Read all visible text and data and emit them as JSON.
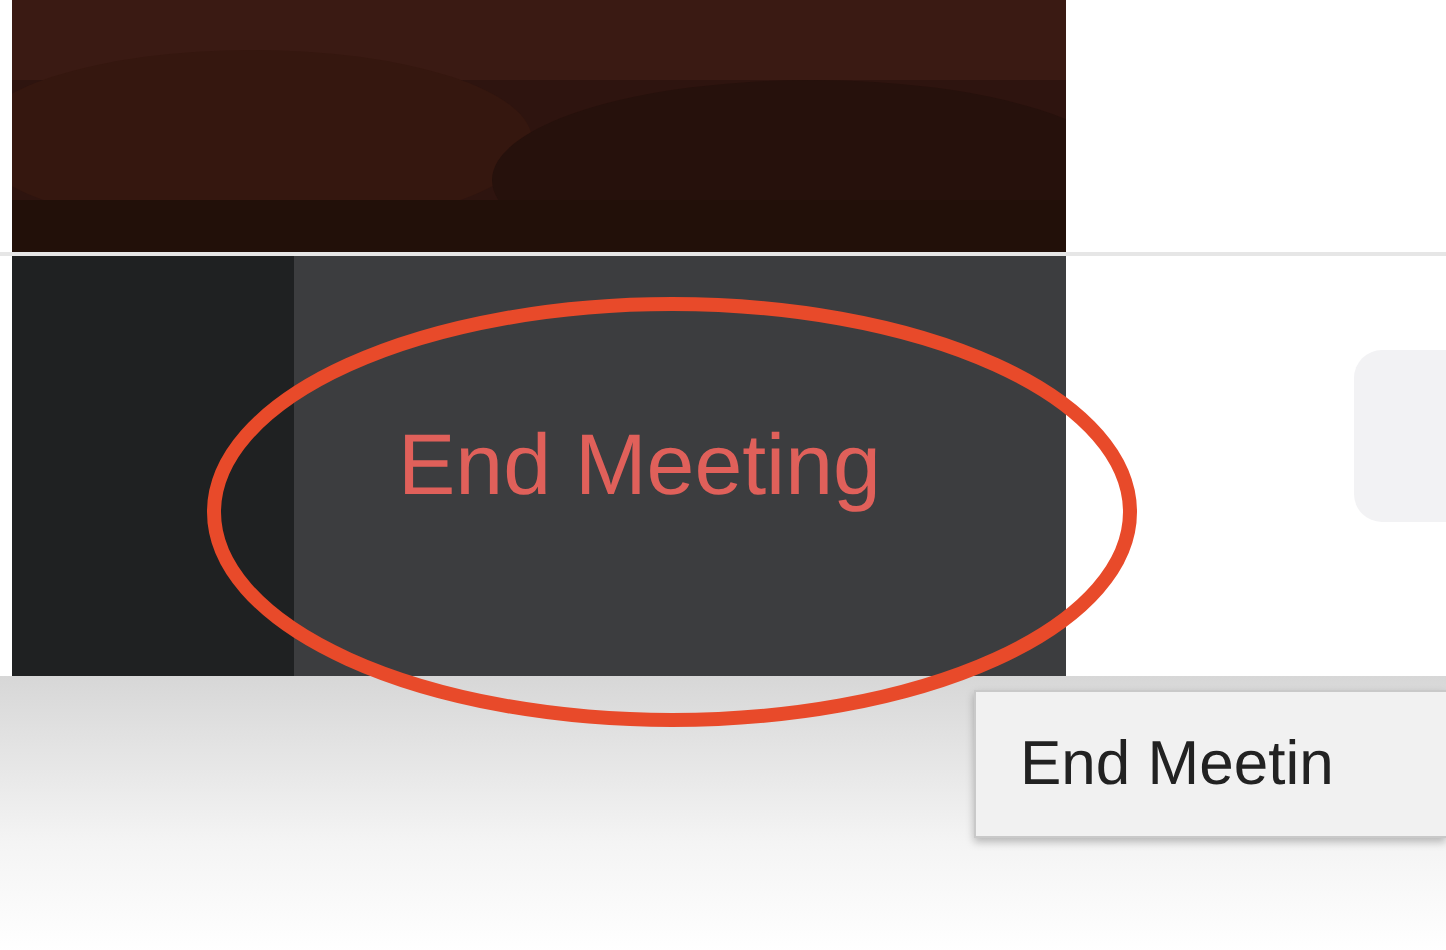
{
  "toolbar": {
    "end_button": {
      "label": "End Meeting"
    }
  },
  "tooltip": {
    "text": "End Meetin"
  }
}
